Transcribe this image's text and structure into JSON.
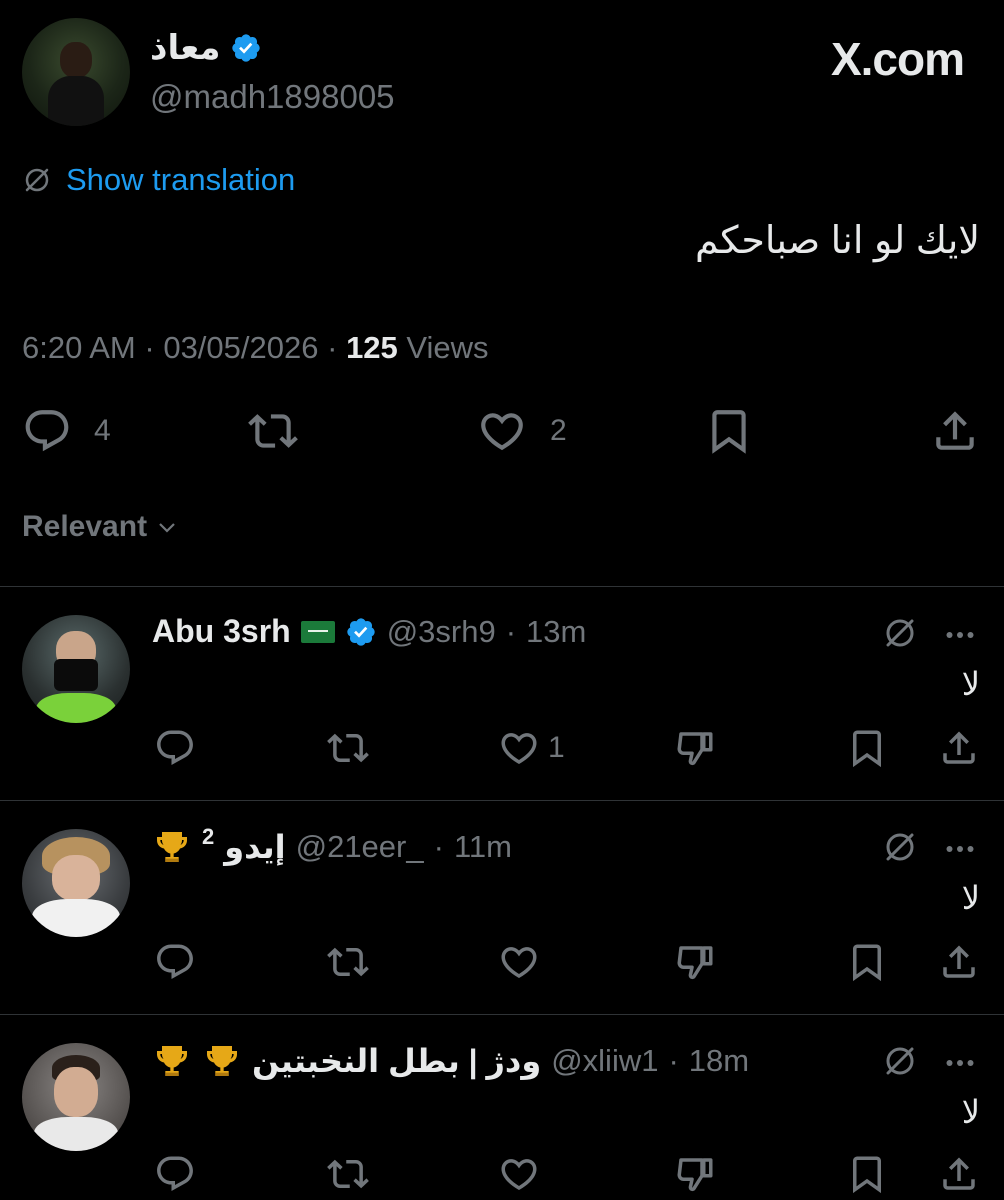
{
  "brand": {
    "logo_text": "X.com"
  },
  "tweet": {
    "author_name": "معاذ",
    "handle": "@madh1898005",
    "show_translation": "Show translation",
    "text": "لايك لو انا صباحكم",
    "time": "6:20 AM",
    "date": "03/05/2026",
    "views_count": "125",
    "views_label": "Views",
    "sep": "·",
    "reply_count": "4",
    "like_count": "2"
  },
  "sort": {
    "label": "Relevant"
  },
  "replies": [
    {
      "name": "Abu 3srh",
      "flag": "saudi-flag-icon",
      "verified": true,
      "handle": "@3srh9",
      "time": "13m",
      "sep": "·",
      "text": "لا",
      "like_count": "1"
    },
    {
      "name": "إيدو",
      "superscript": "2",
      "badge": "trophy-icon",
      "handle": "@21eer_",
      "time": "11m",
      "sep": "·",
      "text": "لا",
      "like_count": ""
    },
    {
      "name": "ودژ | بطل النخبتين",
      "badge": "trophy-icon",
      "handle": "@xliiw1",
      "time": "18m",
      "sep": "·",
      "text": "لا",
      "like_count": ""
    }
  ],
  "colors": {
    "background": "#000000",
    "text": "#e7e9ea",
    "muted": "#71767b",
    "link": "#1d9bf0",
    "verified": "#1d9bf0",
    "divider": "#2f3336"
  }
}
